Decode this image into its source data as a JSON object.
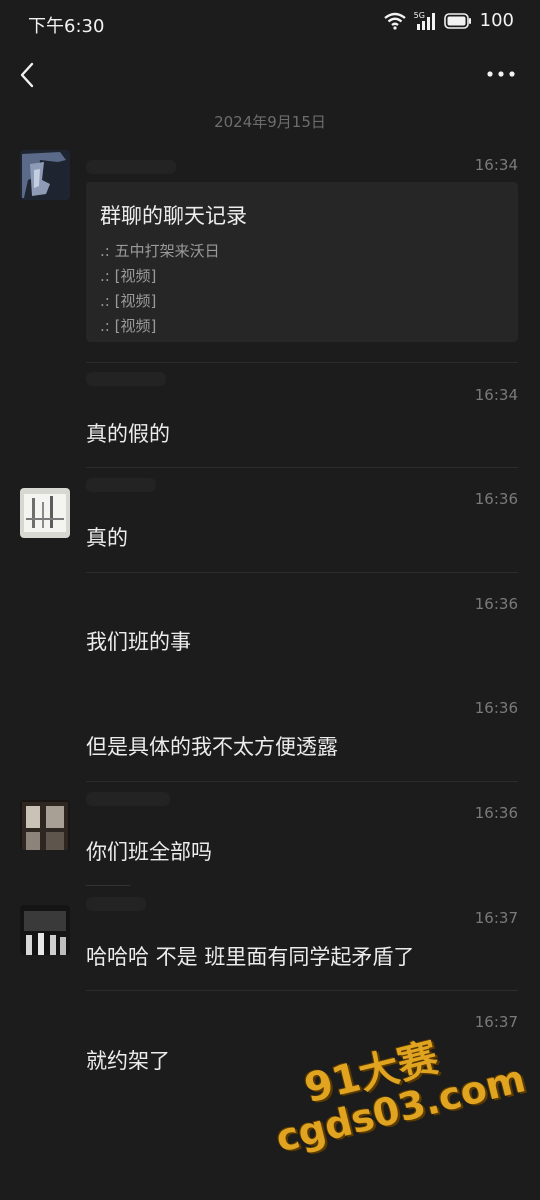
{
  "status_bar": {
    "time": "下午6:30",
    "network": "5G",
    "battery": "100"
  },
  "date_separator": "2024年9月15日",
  "forward_card": {
    "time": "16:34",
    "title": "群聊的聊天记录",
    "lines": [
      ".: 五中打架来沃日",
      ".: [视频]",
      ".: [视频]",
      ".: [视频]"
    ]
  },
  "messages": [
    {
      "time": "16:34",
      "text": "真的假的"
    },
    {
      "time": "16:36",
      "text": "真的"
    },
    {
      "time": "16:36",
      "text": "我们班的事"
    },
    {
      "time": "16:36",
      "text": "但是具体的我不太方便透露"
    },
    {
      "time": "16:36",
      "text": "你们班全部吗"
    },
    {
      "time": "16:37",
      "text": "哈哈哈 不是 班里面有同学起矛盾了"
    },
    {
      "time": "16:37",
      "text": "就约架了"
    }
  ],
  "watermark": {
    "line1": "91大赛",
    "line2": "cgds03.com"
  }
}
